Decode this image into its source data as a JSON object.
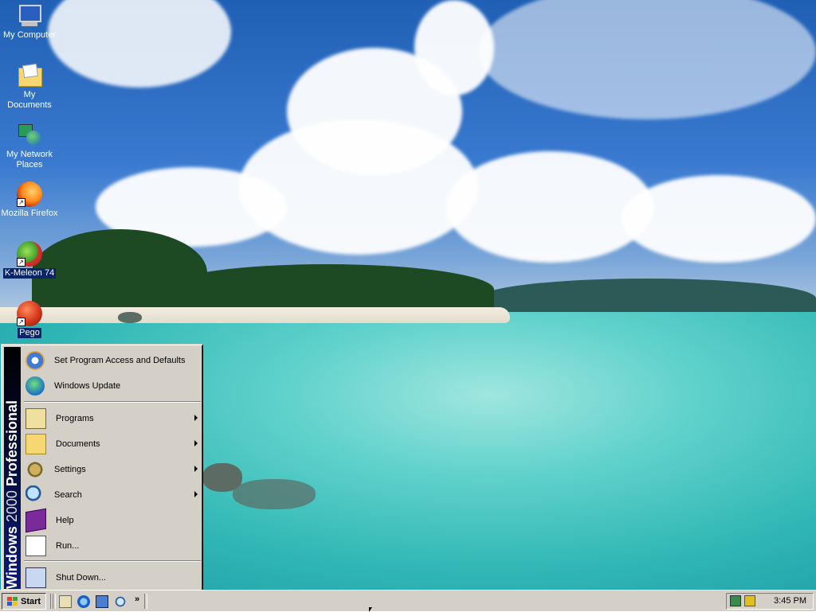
{
  "desktop": {
    "icons": [
      {
        "label": "My Computer",
        "icon": "computer-icon"
      },
      {
        "label": "My Documents",
        "icon": "documents-folder-icon"
      },
      {
        "label": "My Network Places",
        "icon": "network-places-icon"
      },
      {
        "label": "Mozilla Firefox",
        "icon": "firefox-icon"
      },
      {
        "label": "K-Meleon 74",
        "icon": "kmeleon-icon"
      },
      {
        "label": "Pego",
        "icon": "pego-icon"
      }
    ]
  },
  "start_menu": {
    "banner": {
      "brand": "Windows",
      "version": "2000",
      "edition": "Professional"
    },
    "items": [
      {
        "label": "Set Program Access and Defaults",
        "submenu": false
      },
      {
        "label": "Windows Update",
        "submenu": false
      },
      {
        "label": "Programs",
        "submenu": true
      },
      {
        "label": "Documents",
        "submenu": true
      },
      {
        "label": "Settings",
        "submenu": true
      },
      {
        "label": "Search",
        "submenu": true
      },
      {
        "label": "Help",
        "submenu": false
      },
      {
        "label": "Run...",
        "submenu": false
      },
      {
        "label": "Shut Down...",
        "submenu": false
      }
    ]
  },
  "taskbar": {
    "start_label": "Start",
    "quick_launch": [
      "show-desktop-icon",
      "internet-explorer-icon",
      "outlook-express-icon",
      "search-icon"
    ],
    "more_label": "»",
    "clock": "3:45 PM"
  },
  "colors": {
    "face": "#d4d0c8",
    "selection": "#0a246a",
    "banner": "#0a1a7a"
  }
}
